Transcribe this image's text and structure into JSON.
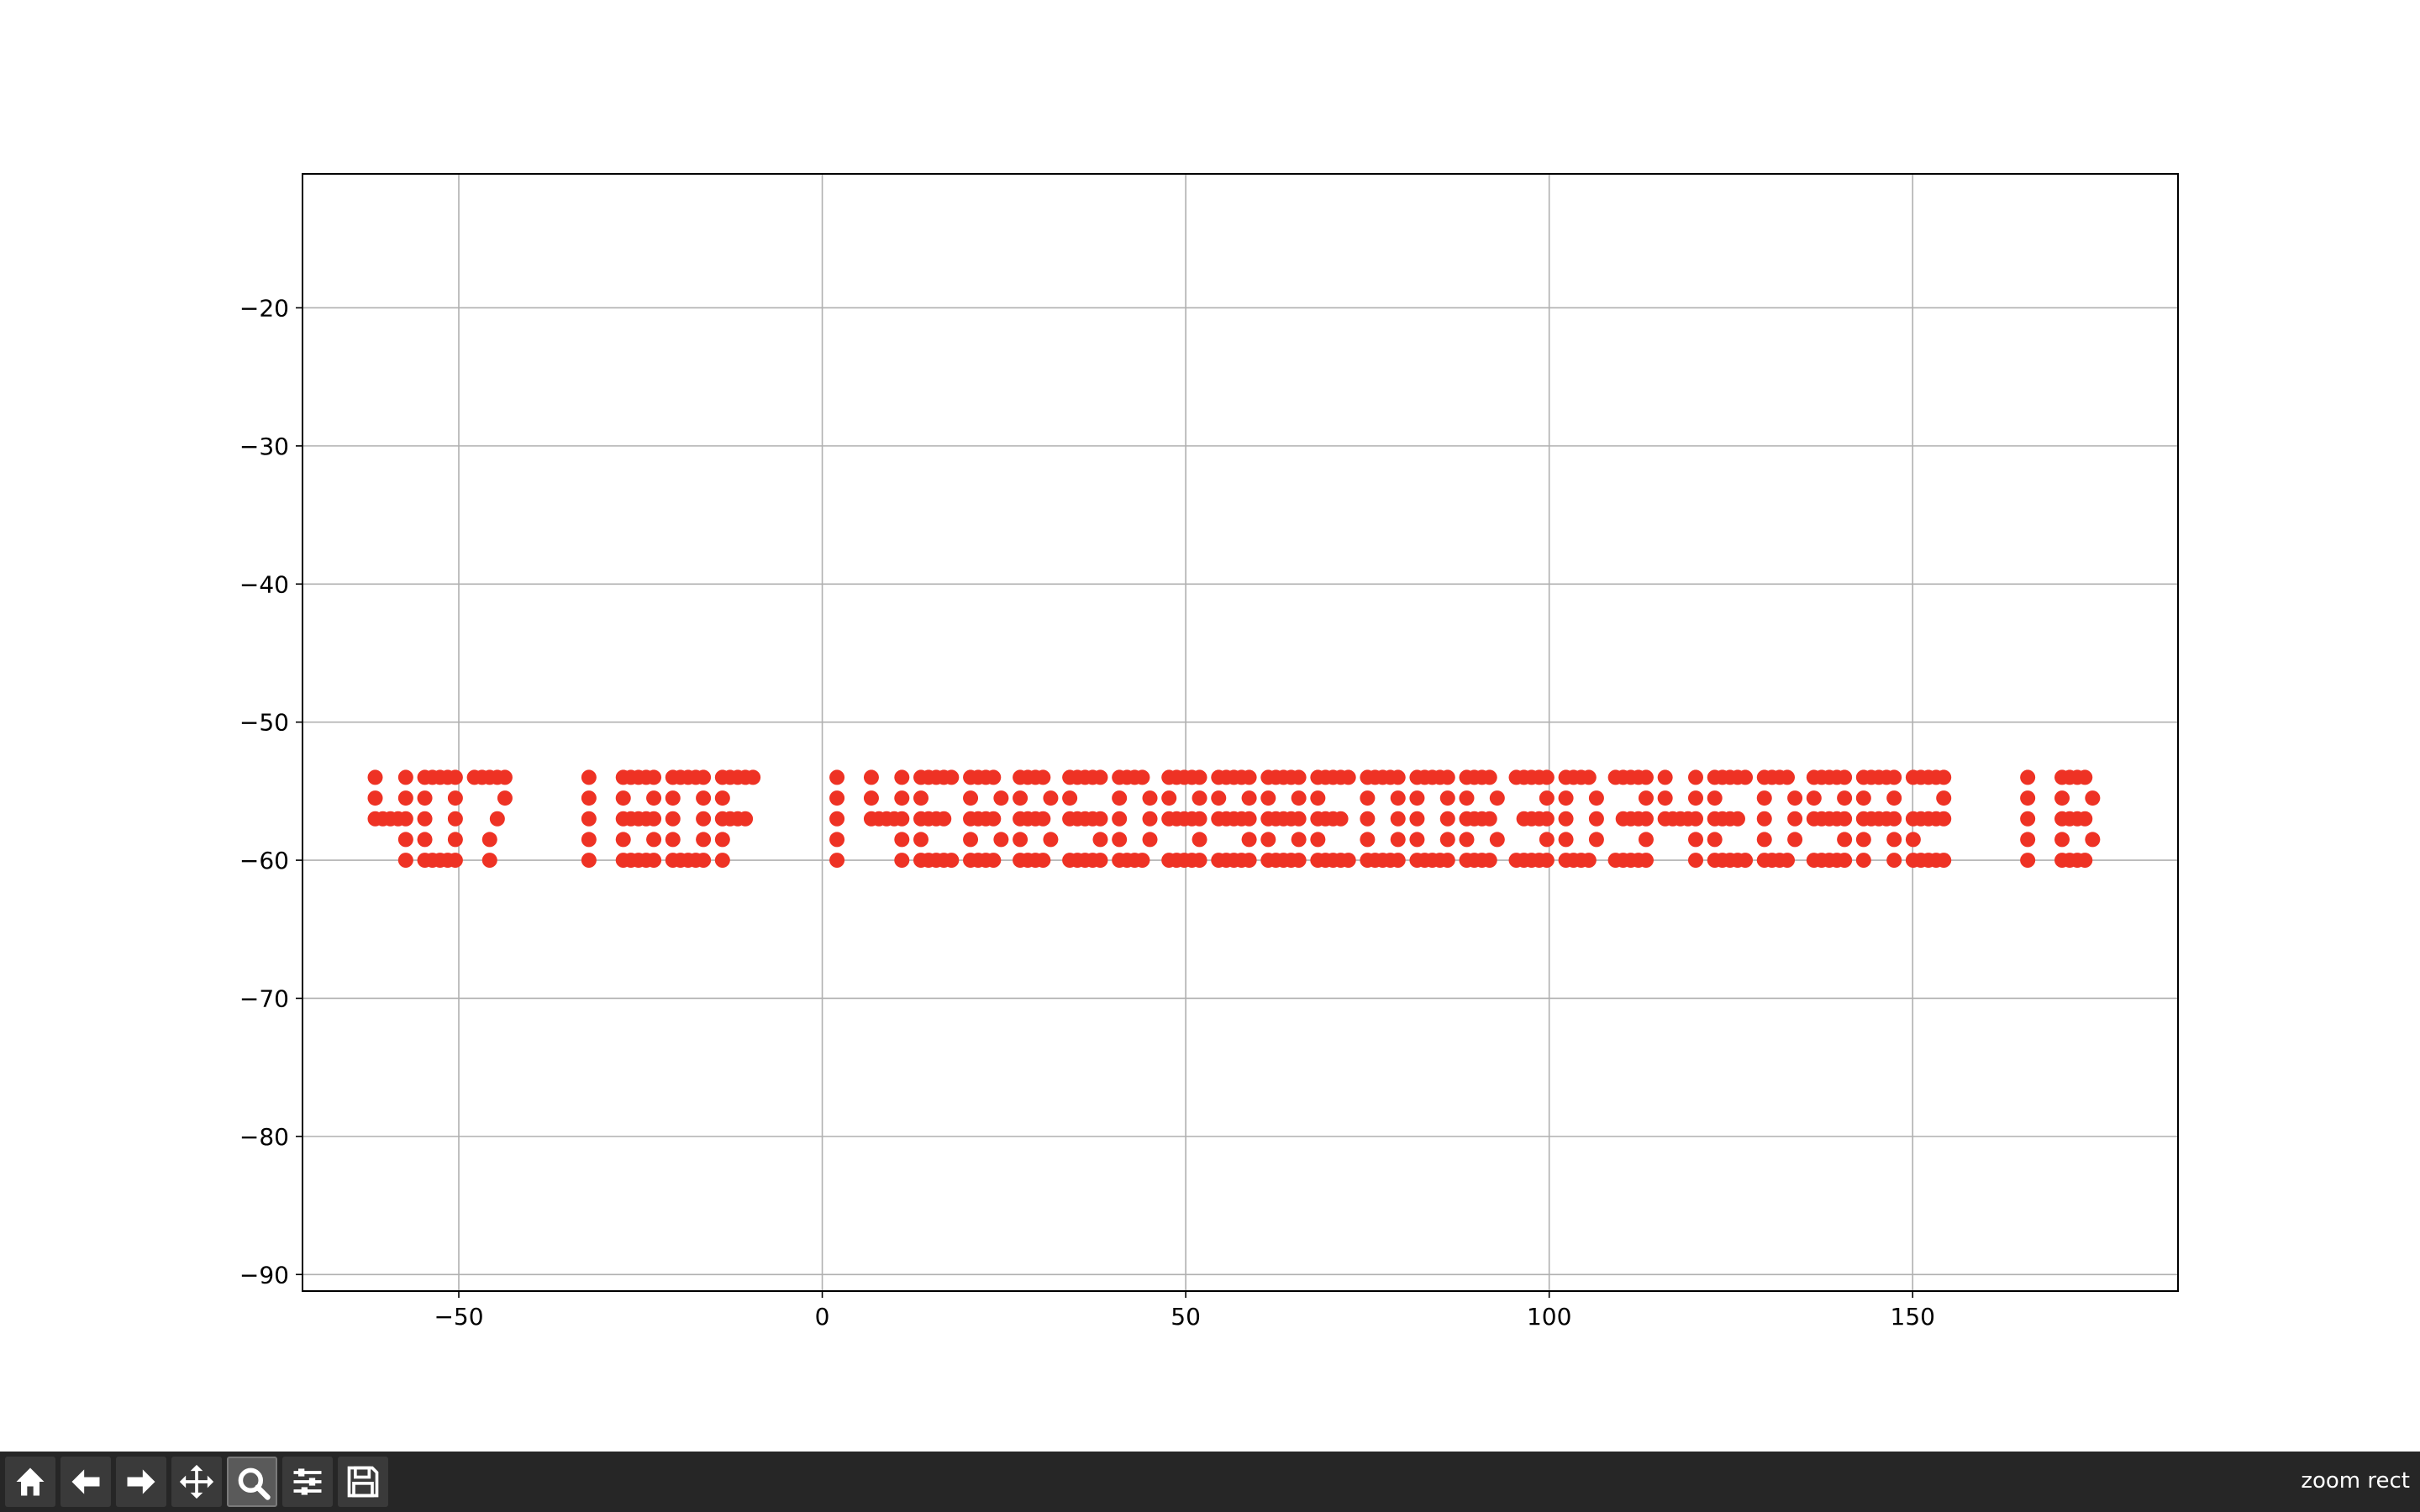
{
  "chart_data": {
    "type": "scatter",
    "title": "",
    "xlabel": "",
    "ylabel": "",
    "xlim": [
      -71.5,
      186.5
    ],
    "ylim": [
      -91.2,
      -10.3
    ],
    "grid": true,
    "xticks": [
      -50,
      0,
      50,
      100,
      150
    ],
    "xtick_labels": [
      "−50",
      "0",
      "50",
      "100",
      "150"
    ],
    "yticks": [
      -20,
      -30,
      -40,
      -50,
      -60,
      -70,
      -80,
      -90
    ],
    "ytick_labels": [
      "−20",
      "−30",
      "−40",
      "−50",
      "−60",
      "−70",
      "−80",
      "−90"
    ],
    "marker_color": "#ee3224",
    "text_rendered": "407 180F 14EBB5D998E00B3D34ED9A2 1B",
    "text_x_start": -61.5,
    "glyph_top_y": -54,
    "glyph_bottom_y": -60,
    "point_spacing": 1.5
  },
  "toolbar": {
    "buttons": [
      {
        "name": "home-button",
        "icon": "home-icon"
      },
      {
        "name": "back-button",
        "icon": "arrow-left-icon"
      },
      {
        "name": "forward-button",
        "icon": "arrow-right-icon"
      },
      {
        "name": "pan-button",
        "icon": "move-icon"
      },
      {
        "name": "zoom-button",
        "icon": "magnifier-icon",
        "active": true
      },
      {
        "name": "configure-subplots-button",
        "icon": "sliders-icon"
      },
      {
        "name": "save-button",
        "icon": "floppy-disk-icon"
      }
    ],
    "status": "zoom rect"
  },
  "colors": {
    "toolbar_bg": "#262626",
    "grid": "#b0b0b0",
    "axes": "#000000",
    "points": "#ee3224"
  }
}
